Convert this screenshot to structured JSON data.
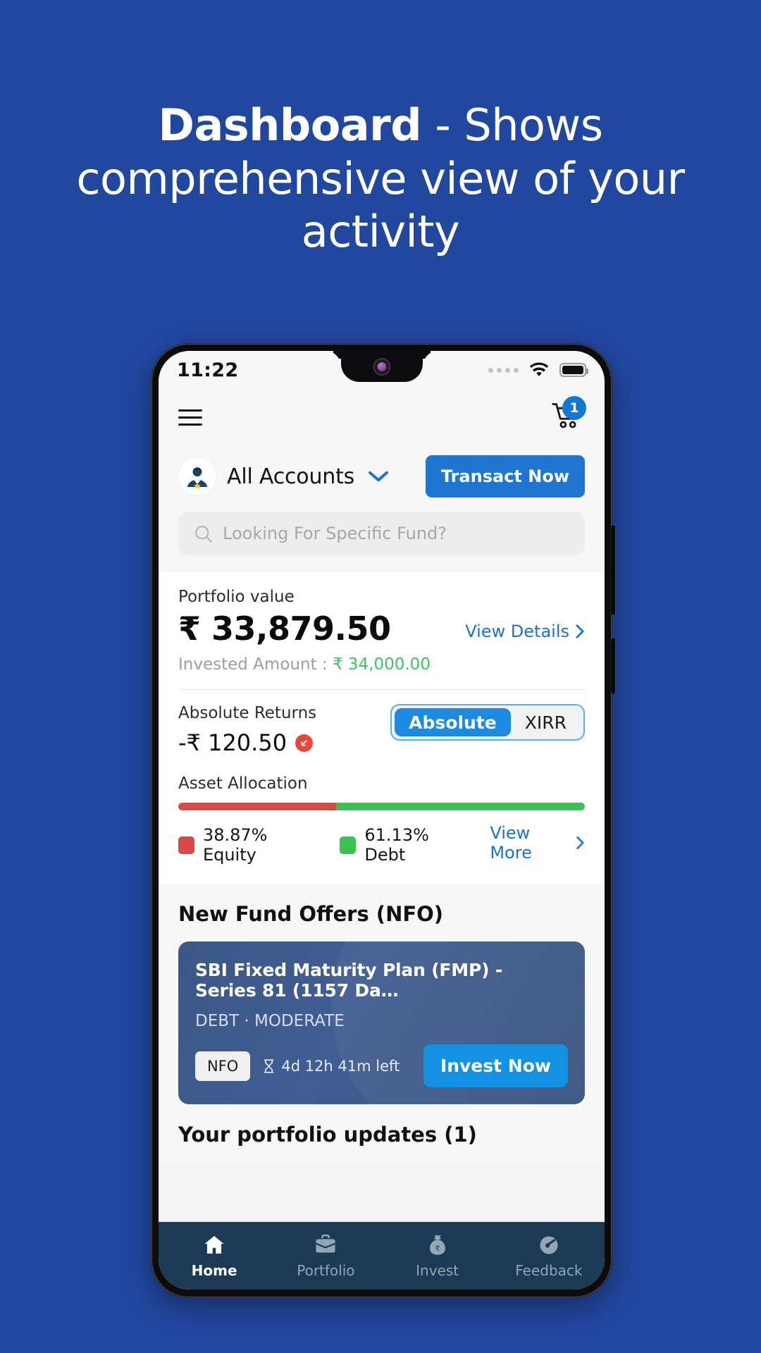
{
  "promo": {
    "headline_strong": "Dashboard",
    "headline_rest": " - Shows comprehensive view of your activity",
    "background_color": "#22479f"
  },
  "status_bar": {
    "time": "11:22",
    "signal_icon": "signal-dots-icon",
    "wifi_icon": "wifi-icon",
    "battery_icon": "battery-full-icon"
  },
  "header": {
    "menu_icon": "hamburger-menu-icon",
    "cart_icon": "shopping-cart-icon",
    "cart_badge": "1"
  },
  "account": {
    "avatar_icon": "user-avatar-icon",
    "name": "All Accounts",
    "chevron_icon": "chevron-down-icon",
    "transact_label": "Transact Now"
  },
  "search": {
    "icon": "search-icon",
    "placeholder": "Looking For Specific Fund?"
  },
  "portfolio": {
    "value_label": "Portfolio value",
    "value": "₹ 33,879.50",
    "view_details": "View Details",
    "view_details_chevron": "chevron-right-icon",
    "invested_label": "Invested Amount : ",
    "invested_value": "₹ 34,000.00",
    "invested_color": "#3cc463"
  },
  "returns": {
    "label": "Absolute Returns",
    "value": "-₹ 120.50",
    "trend_icon": "arrow-down-right-icon",
    "trend_color": "#e8483c",
    "toggle_active": "Absolute",
    "toggle_inactive": "XIRR"
  },
  "asset_allocation": {
    "label": "Asset Allocation",
    "view_more": "View More",
    "view_more_chevron": "chevron-right-icon",
    "segments": [
      {
        "label": "38.87% Equity",
        "percent": 38.87,
        "color": "#d94a47"
      },
      {
        "label": "61.13% Debt",
        "percent": 61.13,
        "color": "#38c353"
      }
    ]
  },
  "nfo": {
    "section_title": "New Fund Offers (NFO)",
    "fund_name": "SBI Fixed Maturity Plan (FMP) - Series 81 (1157 Da…",
    "category": "DEBT  ·  MODERATE",
    "chip": "NFO",
    "timer_icon": "hourglass-icon",
    "timer": "4d 12h 41m left",
    "invest_label": "Invest Now"
  },
  "updates": {
    "title": "Your portfolio updates (1)"
  },
  "bottom_nav": {
    "items": [
      {
        "label": "Home",
        "icon": "home-icon",
        "active": true
      },
      {
        "label": "Portfolio",
        "icon": "briefcase-icon",
        "active": false
      },
      {
        "label": "Invest",
        "icon": "money-bag-rupee-icon",
        "active": false
      },
      {
        "label": "Feedback",
        "icon": "speedometer-icon",
        "active": false
      }
    ]
  }
}
